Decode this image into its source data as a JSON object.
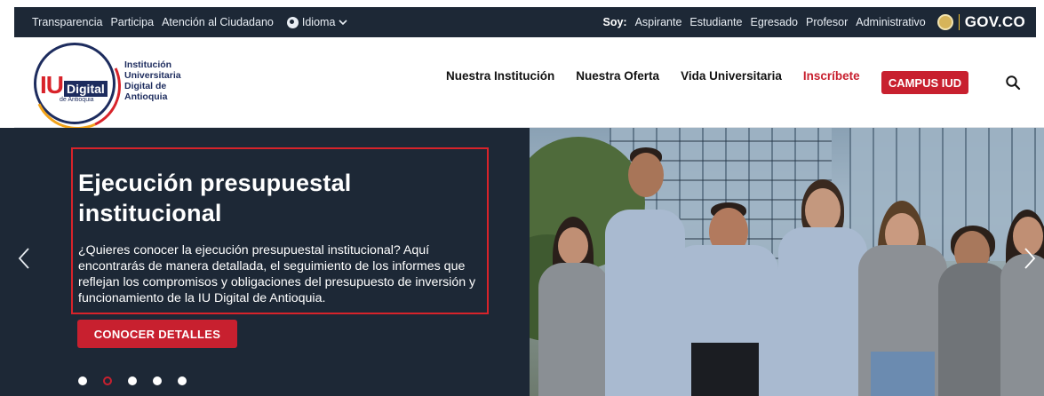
{
  "topbar": {
    "left_links": [
      "Transparencia",
      "Participa",
      "Atención al Ciudadano"
    ],
    "language_label": "Idioma",
    "soy_label": "Soy:",
    "roles": [
      "Aspirante",
      "Estudiante",
      "Egresado",
      "Profesor",
      "Administrativo"
    ],
    "gov_label": "GOV.CO"
  },
  "header": {
    "logo": {
      "iu": "IU",
      "digital": "Digital",
      "sub": "de Antioquia"
    },
    "institution_name": [
      "Institución",
      "Universitaria",
      "Digital de",
      "Antioquia"
    ],
    "nav": [
      "Nuestra Institución",
      "Nuestra Oferta",
      "Vida Universitaria",
      "Inscríbete"
    ],
    "campus_button": "CAMPUS IUD"
  },
  "hero": {
    "title": "Ejecución presupuestal institucional",
    "description": "¿Quieres conocer la ejecución presupuestal institucional? Aquí encontrarás de manera detallada, el seguimiento de los informes que reflejan los compromisos y obligaciones del presupuesto de inversión y funcionamiento de la IU Digital de Antioquia.",
    "cta": "CONOCER DETALLES",
    "slide_count": 5,
    "active_slide": 2
  },
  "icons": {
    "language": "globe-icon",
    "dropdown": "chevron-down-icon",
    "search": "search-icon",
    "prev": "chevron-left-icon",
    "next": "chevron-right-icon",
    "gov_seal": "colombia-seal-icon"
  },
  "colors": {
    "dark_navy": "#1d2836",
    "brand_red": "#c8202f",
    "logo_navy": "#1d2c5e"
  }
}
